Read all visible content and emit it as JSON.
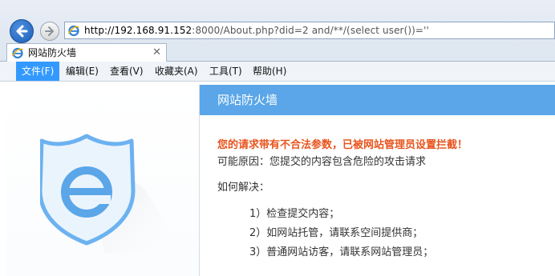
{
  "address_bar": {
    "url_host": "http://192.168.91.152",
    "url_rest": ":8000/About.php?did=2 and/**/(select user())=''"
  },
  "tab": {
    "title": "网站防火墙",
    "close_glyph": "✕"
  },
  "menu": {
    "items": [
      "文件(F)",
      "编辑(E)",
      "查看(V)",
      "收藏夹(A)",
      "工具(T)",
      "帮助(H)"
    ],
    "active_index": 0
  },
  "page": {
    "header_title": "网站防火墙",
    "warning": "您的请求带有不合法参数，已被网站管理员设置拦截！",
    "reason": "可能原因：您提交的内容包含危险的攻击请求",
    "howto": "如何解决：",
    "steps": [
      "1）检查提交内容；",
      "2）如网站托管，请联系空间提供商；",
      "3）普通网站访客，请联系网站管理员；"
    ]
  },
  "colors": {
    "accent": "#5aa6e8",
    "warning": "#e8541d",
    "menu_active": "#3399ff"
  },
  "icons": {
    "back": "back-arrow-icon",
    "forward": "forward-arrow-icon",
    "page": "ie-page-icon",
    "logo": "shield-e-logo-icon"
  }
}
